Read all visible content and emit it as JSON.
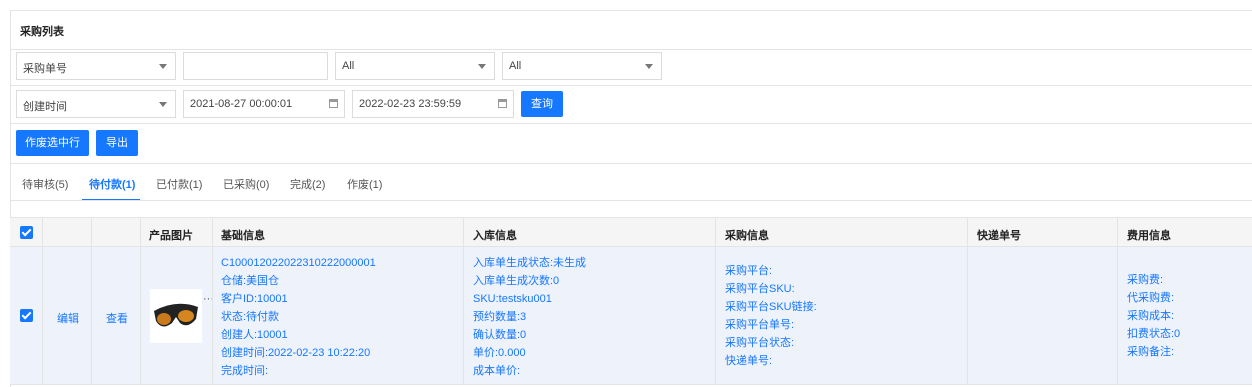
{
  "header": {
    "title": "采购列表"
  },
  "filters": {
    "row1": {
      "select1": "采购单号",
      "input": "",
      "select2": "All",
      "select3": "All"
    },
    "row2": {
      "select1": "创建时间",
      "start": "2021-08-27 00:00:01",
      "end": "2022-02-23 23:59:59",
      "query_label": "查询"
    }
  },
  "actions": {
    "void_label": "作废选中行",
    "export_label": "导出"
  },
  "tabs": [
    {
      "label": "待审核(5)"
    },
    {
      "label": "待付款(1)"
    },
    {
      "label": "已付款(1)"
    },
    {
      "label": "已采购(0)"
    },
    {
      "label": "完成(2)"
    },
    {
      "label": "作废(1)"
    }
  ],
  "active_tab": 1,
  "table": {
    "columns": [
      "产品图片",
      "基础信息",
      "入库信息",
      "采购信息",
      "快递单号",
      "费用信息"
    ],
    "row": {
      "edit": "编辑",
      "view": "查看",
      "basic": [
        "C10001202202231022200000​1",
        "仓储:美国仓",
        "客户ID:10001",
        "状态:待付款",
        "创建人:10001",
        "创建时间:2022-02-23 10:22:20",
        "完成时间:"
      ],
      "inbound": [
        "入库单生成状态:未生成",
        "入库单生成次数:0",
        "SKU:testsku001",
        "预约数量:3",
        "确认数量:0",
        "单价:0.000",
        "成本单价:"
      ],
      "purchase": [
        "采购平台:",
        "采购平台SKU:",
        "采购平台SKU链接:",
        "采购平台单号:",
        "采购平台状态:",
        "快递单号:"
      ],
      "fees": [
        "采购费:",
        "代采购费:",
        "采购成本:",
        "扣费状态:0",
        "采购备注:"
      ]
    }
  }
}
